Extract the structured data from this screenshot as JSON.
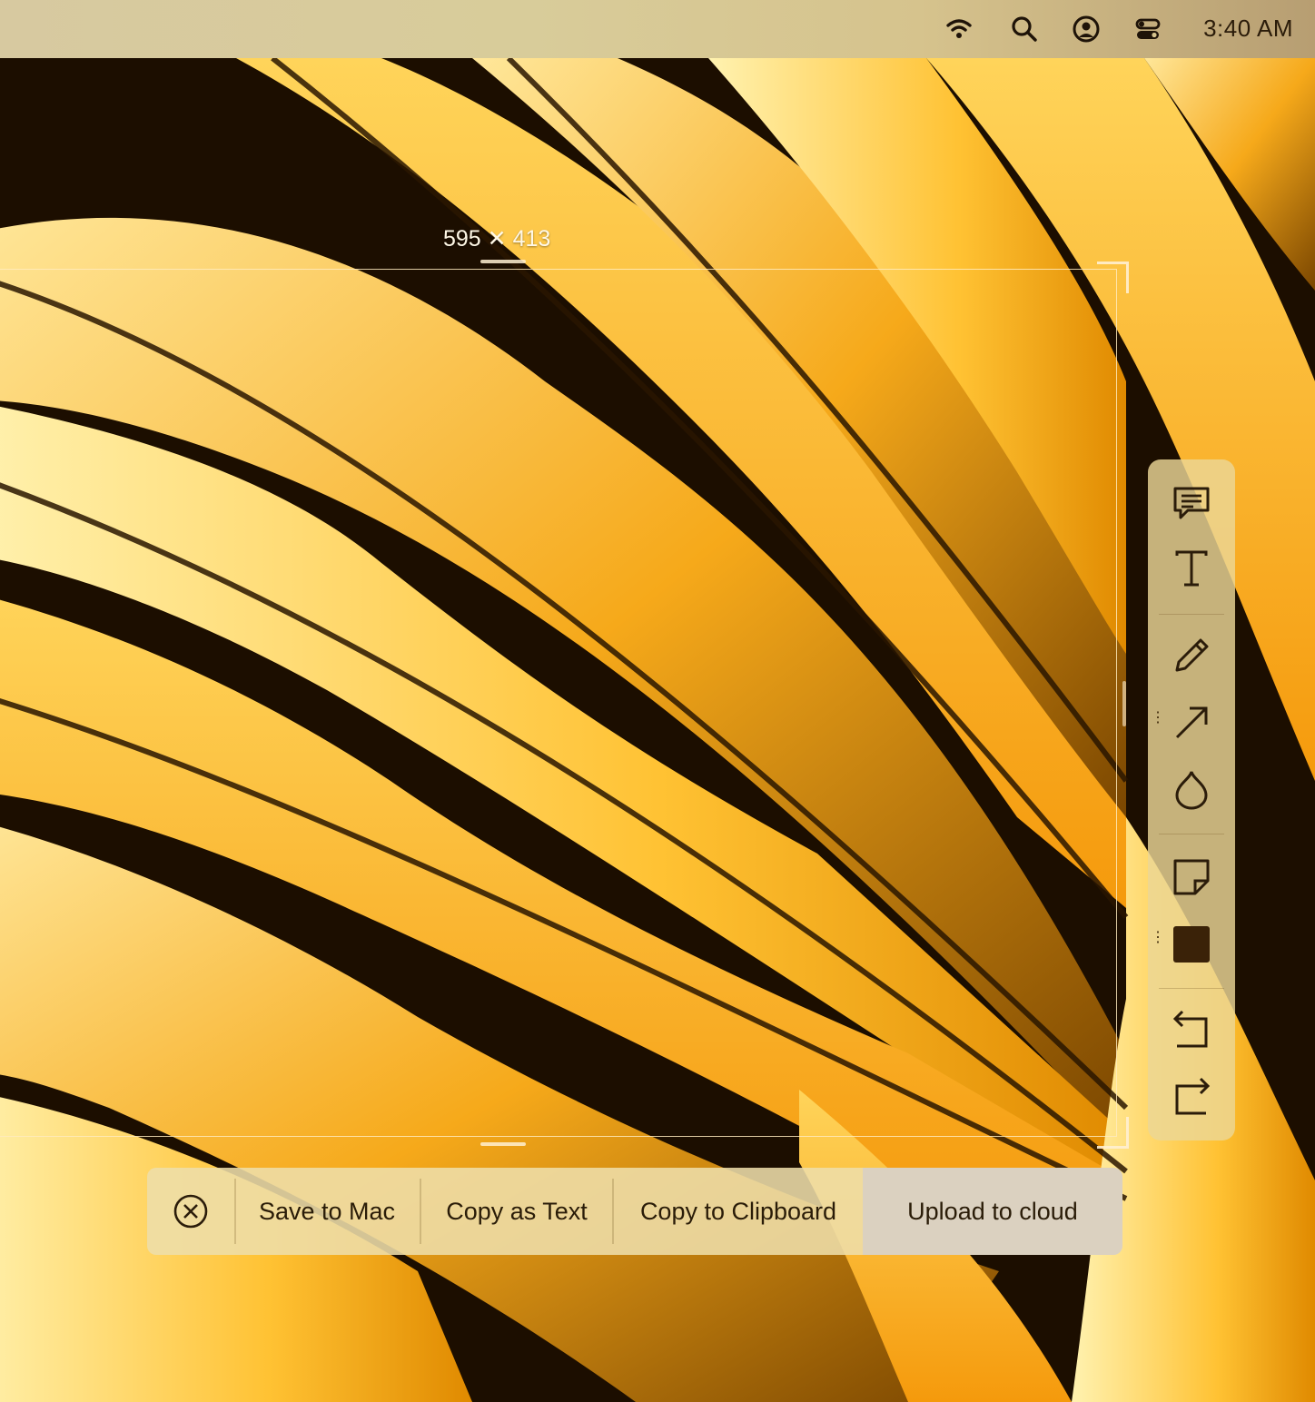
{
  "menubar": {
    "wifi_icon": "wifi-icon",
    "search_icon": "search-icon",
    "user_icon": "user-circle-icon",
    "control_icon": "control-center-icon",
    "clock": "3:40 AM"
  },
  "selection": {
    "dimensions_width": "595",
    "dimensions_height": "413"
  },
  "toolbar": {
    "tools": [
      "comment-icon",
      "text-icon",
      "pencil-icon",
      "arrow-icon",
      "droplet-icon",
      "sticky-note-icon",
      "filled-square-icon",
      "undo-icon",
      "redo-icon"
    ],
    "colors": {
      "panel": "#ebd796",
      "ink": "#2b1c0a",
      "fill_square": "#3a2208"
    }
  },
  "actions": {
    "close_icon": "close-circle-icon",
    "save_label": "Save to Mac",
    "copy_text_label": "Copy as Text",
    "copy_clipboard_label": "Copy to Clipboard",
    "upload_label": "Upload to cloud"
  }
}
